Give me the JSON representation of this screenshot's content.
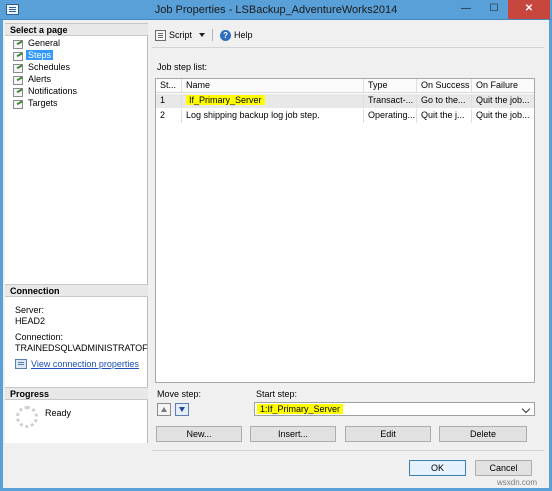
{
  "window": {
    "title": "Job Properties - LSBackup_AdventureWorks2014",
    "minimize": "—",
    "maximize": "☐",
    "close": "✕"
  },
  "left_pane": {
    "select_page_header": "Select a page",
    "pages": [
      {
        "label": "General",
        "selected": false
      },
      {
        "label": "Steps",
        "selected": true
      },
      {
        "label": "Schedules",
        "selected": false
      },
      {
        "label": "Alerts",
        "selected": false
      },
      {
        "label": "Notifications",
        "selected": false
      },
      {
        "label": "Targets",
        "selected": false
      }
    ],
    "connection_header": "Connection",
    "server_label": "Server:",
    "server_value": "HEAD2",
    "connection_label": "Connection:",
    "connection_value": "TRAINEDSQL\\ADMINISTRATOF",
    "view_link": "View connection properties",
    "progress_header": "Progress",
    "progress_status": "Ready"
  },
  "toolbar": {
    "script_label": "Script",
    "help_label": "Help"
  },
  "job_steps": {
    "list_label": "Job step list:",
    "columns": [
      "St...",
      "Name",
      "Type",
      "On Success",
      "On Failure"
    ],
    "rows": [
      {
        "step": "1",
        "name": "If_Primary_Server",
        "type": "Transact-...",
        "on_success": "Go to the...",
        "on_failure": "Quit the job..."
      },
      {
        "step": "2",
        "name": "Log shipping backup log job step.",
        "type": "Operating...",
        "on_success": "Quit the j...",
        "on_failure": "Quit the job..."
      }
    ]
  },
  "move_step": {
    "label": "Move step:"
  },
  "start_step": {
    "label": "Start step:",
    "value": "1:If_Primary_Server"
  },
  "buttons": {
    "new": "New...",
    "insert": "Insert...",
    "edit": "Edit",
    "delete": "Delete",
    "ok": "OK",
    "cancel": "Cancel"
  },
  "watermark": "wsxdn.com",
  "colors": {
    "title_bar": "#5aa0d8",
    "selection": "#3399ff",
    "highlight": "#ffff00",
    "close_button": "#c7473f"
  },
  "icons": [
    "app-icon",
    "page-icon",
    "connection-properties-icon",
    "script-icon",
    "help-icon",
    "move-up-icon",
    "move-down-icon",
    "dropdown-chevron-icon",
    "progress-spinner-icon"
  ]
}
